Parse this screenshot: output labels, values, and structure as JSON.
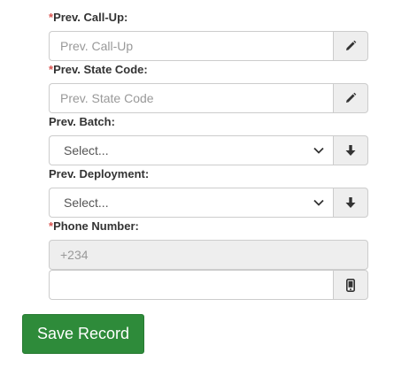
{
  "form": {
    "prev_callup": {
      "required_mark": "*",
      "label": "Prev. Call-Up:",
      "placeholder": "Prev. Call-Up",
      "value": "",
      "addon_icon": "pencil-icon"
    },
    "prev_state_code": {
      "required_mark": "*",
      "label": "Prev. State Code:",
      "placeholder": "Prev. State Code",
      "value": "",
      "addon_icon": "pencil-icon"
    },
    "prev_batch": {
      "label": "Prev. Batch:",
      "selected": "Select...",
      "addon_icon": "arrow-down-icon"
    },
    "prev_deployment": {
      "label": "Prev. Deployment:",
      "selected": "Select...",
      "addon_icon": "arrow-down-icon"
    },
    "phone": {
      "required_mark": "*",
      "label": "Phone Number:",
      "country_code": "+234",
      "value": "",
      "addon_icon": "mobile-phone-icon"
    }
  },
  "actions": {
    "save_label": "Save Record",
    "save_color": "#2e8b3a"
  },
  "colors": {
    "required": "#d9534f",
    "addon_bg": "#eeeeee",
    "border": "#cccccc"
  }
}
